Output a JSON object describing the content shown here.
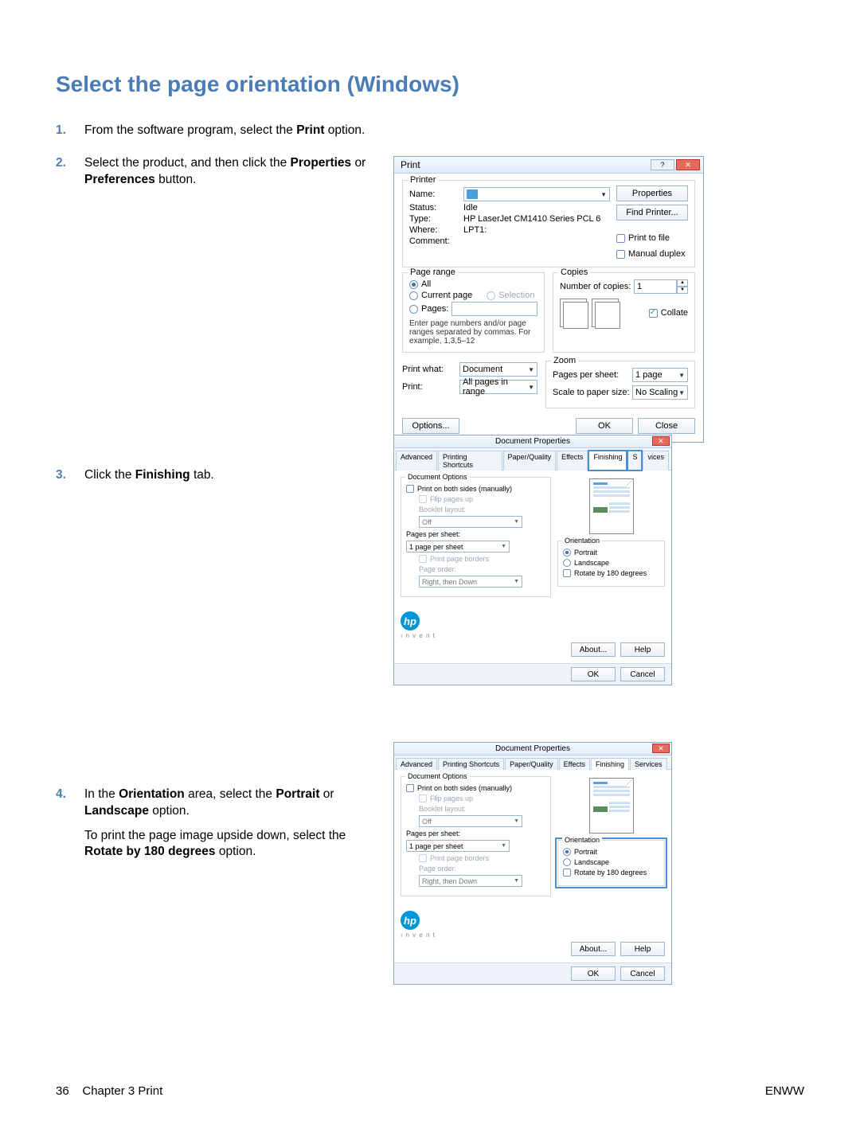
{
  "heading": "Select the page orientation (Windows)",
  "steps": {
    "s1": {
      "pre": "From the software program, select the ",
      "b": "Print",
      "post": " option."
    },
    "s2": {
      "pre": "Select the product, and then click the ",
      "b1": "Properties",
      "mid": " or ",
      "b2": "Preferences",
      "post": " button."
    },
    "s3": {
      "pre": "Click the ",
      "b": "Finishing",
      "post": " tab."
    },
    "s4": {
      "l1": {
        "pre": "In the ",
        "b1": "Orientation",
        "mid": " area, select the ",
        "b2": "Portrait",
        "mid2": " or ",
        "b3": "Landscape",
        "post": " option."
      },
      "l2": {
        "pre": "To print the page image upside down, select the ",
        "b": "Rotate by 180 degrees",
        "post": " option."
      }
    }
  },
  "footer": {
    "left_pageno": "36",
    "left_chap": "Chapter 3   Print",
    "right": "ENWW"
  },
  "printDialog": {
    "title": "Print",
    "printer": {
      "legend": "Printer",
      "name_lbl": "Name:",
      "name_val": "",
      "status_lbl": "Status:",
      "status_val": "Idle",
      "type_lbl": "Type:",
      "type_val": "HP LaserJet CM1410 Series PCL 6",
      "where_lbl": "Where:",
      "where_val": "LPT1:",
      "comment_lbl": "Comment:",
      "comment_val": "",
      "properties_btn": "Properties",
      "findprinter_btn": "Find Printer...",
      "print_to_file": "Print to file",
      "manual_duplex": "Manual duplex"
    },
    "pageRange": {
      "legend": "Page range",
      "all": "All",
      "current": "Current page",
      "selection": "Selection",
      "pages": "Pages:",
      "note": "Enter page numbers and/or page ranges separated by commas. For example, 1,3,5–12"
    },
    "copies": {
      "legend": "Copies",
      "num_lbl": "Number of copies:",
      "num_val": "1",
      "collate": "Collate"
    },
    "printwhat": {
      "lbl": "Print what:",
      "val": "Document"
    },
    "printsel": {
      "lbl": "Print:",
      "val": "All pages in range"
    },
    "zoom": {
      "legend": "Zoom",
      "pps_lbl": "Pages per sheet:",
      "pps_val": "1 page",
      "scale_lbl": "Scale to paper size:",
      "scale_val": "No Scaling"
    },
    "options_btn": "Options...",
    "ok_btn": "OK",
    "close_btn": "Close",
    "name_underline": "N",
    "all_underline": "A",
    "current_underline": "u",
    "pages_underline": "g",
    "printwhat_underline": "w",
    "collate_underline": "t",
    "options_underline": "O",
    "properties_underline": "P",
    "findprinter_underline": "d",
    "printfile_underline": "l",
    "manualdup_underline": "x"
  },
  "propsDialog": {
    "title": "Document Properties",
    "tabs": [
      "Advanced",
      "Printing Shortcuts",
      "Paper/Quality",
      "Effects",
      "Finishing",
      "Services"
    ],
    "activeTab": "Finishing",
    "split_tab_left": "S",
    "split_tab_right": "vices",
    "docOptions": {
      "legend": "Document Options",
      "both_sides": "Print on both sides (manually)",
      "flip": "Flip pages up",
      "booklet_lbl": "Booklet layout:",
      "booklet_val": "Off",
      "pps_lbl": "Pages per sheet:",
      "pps_val": "1 page per sheet",
      "borders": "Print page borders",
      "order_lbl": "Page order:",
      "order_val": "Right, then Down"
    },
    "orientation": {
      "legend": "Orientation",
      "portrait": "Portrait",
      "landscape": "Landscape",
      "rotate": "Rotate by 180 degrees"
    },
    "about_btn": "About...",
    "help_btn": "Help",
    "ok_btn": "OK",
    "cancel_btn": "Cancel"
  }
}
